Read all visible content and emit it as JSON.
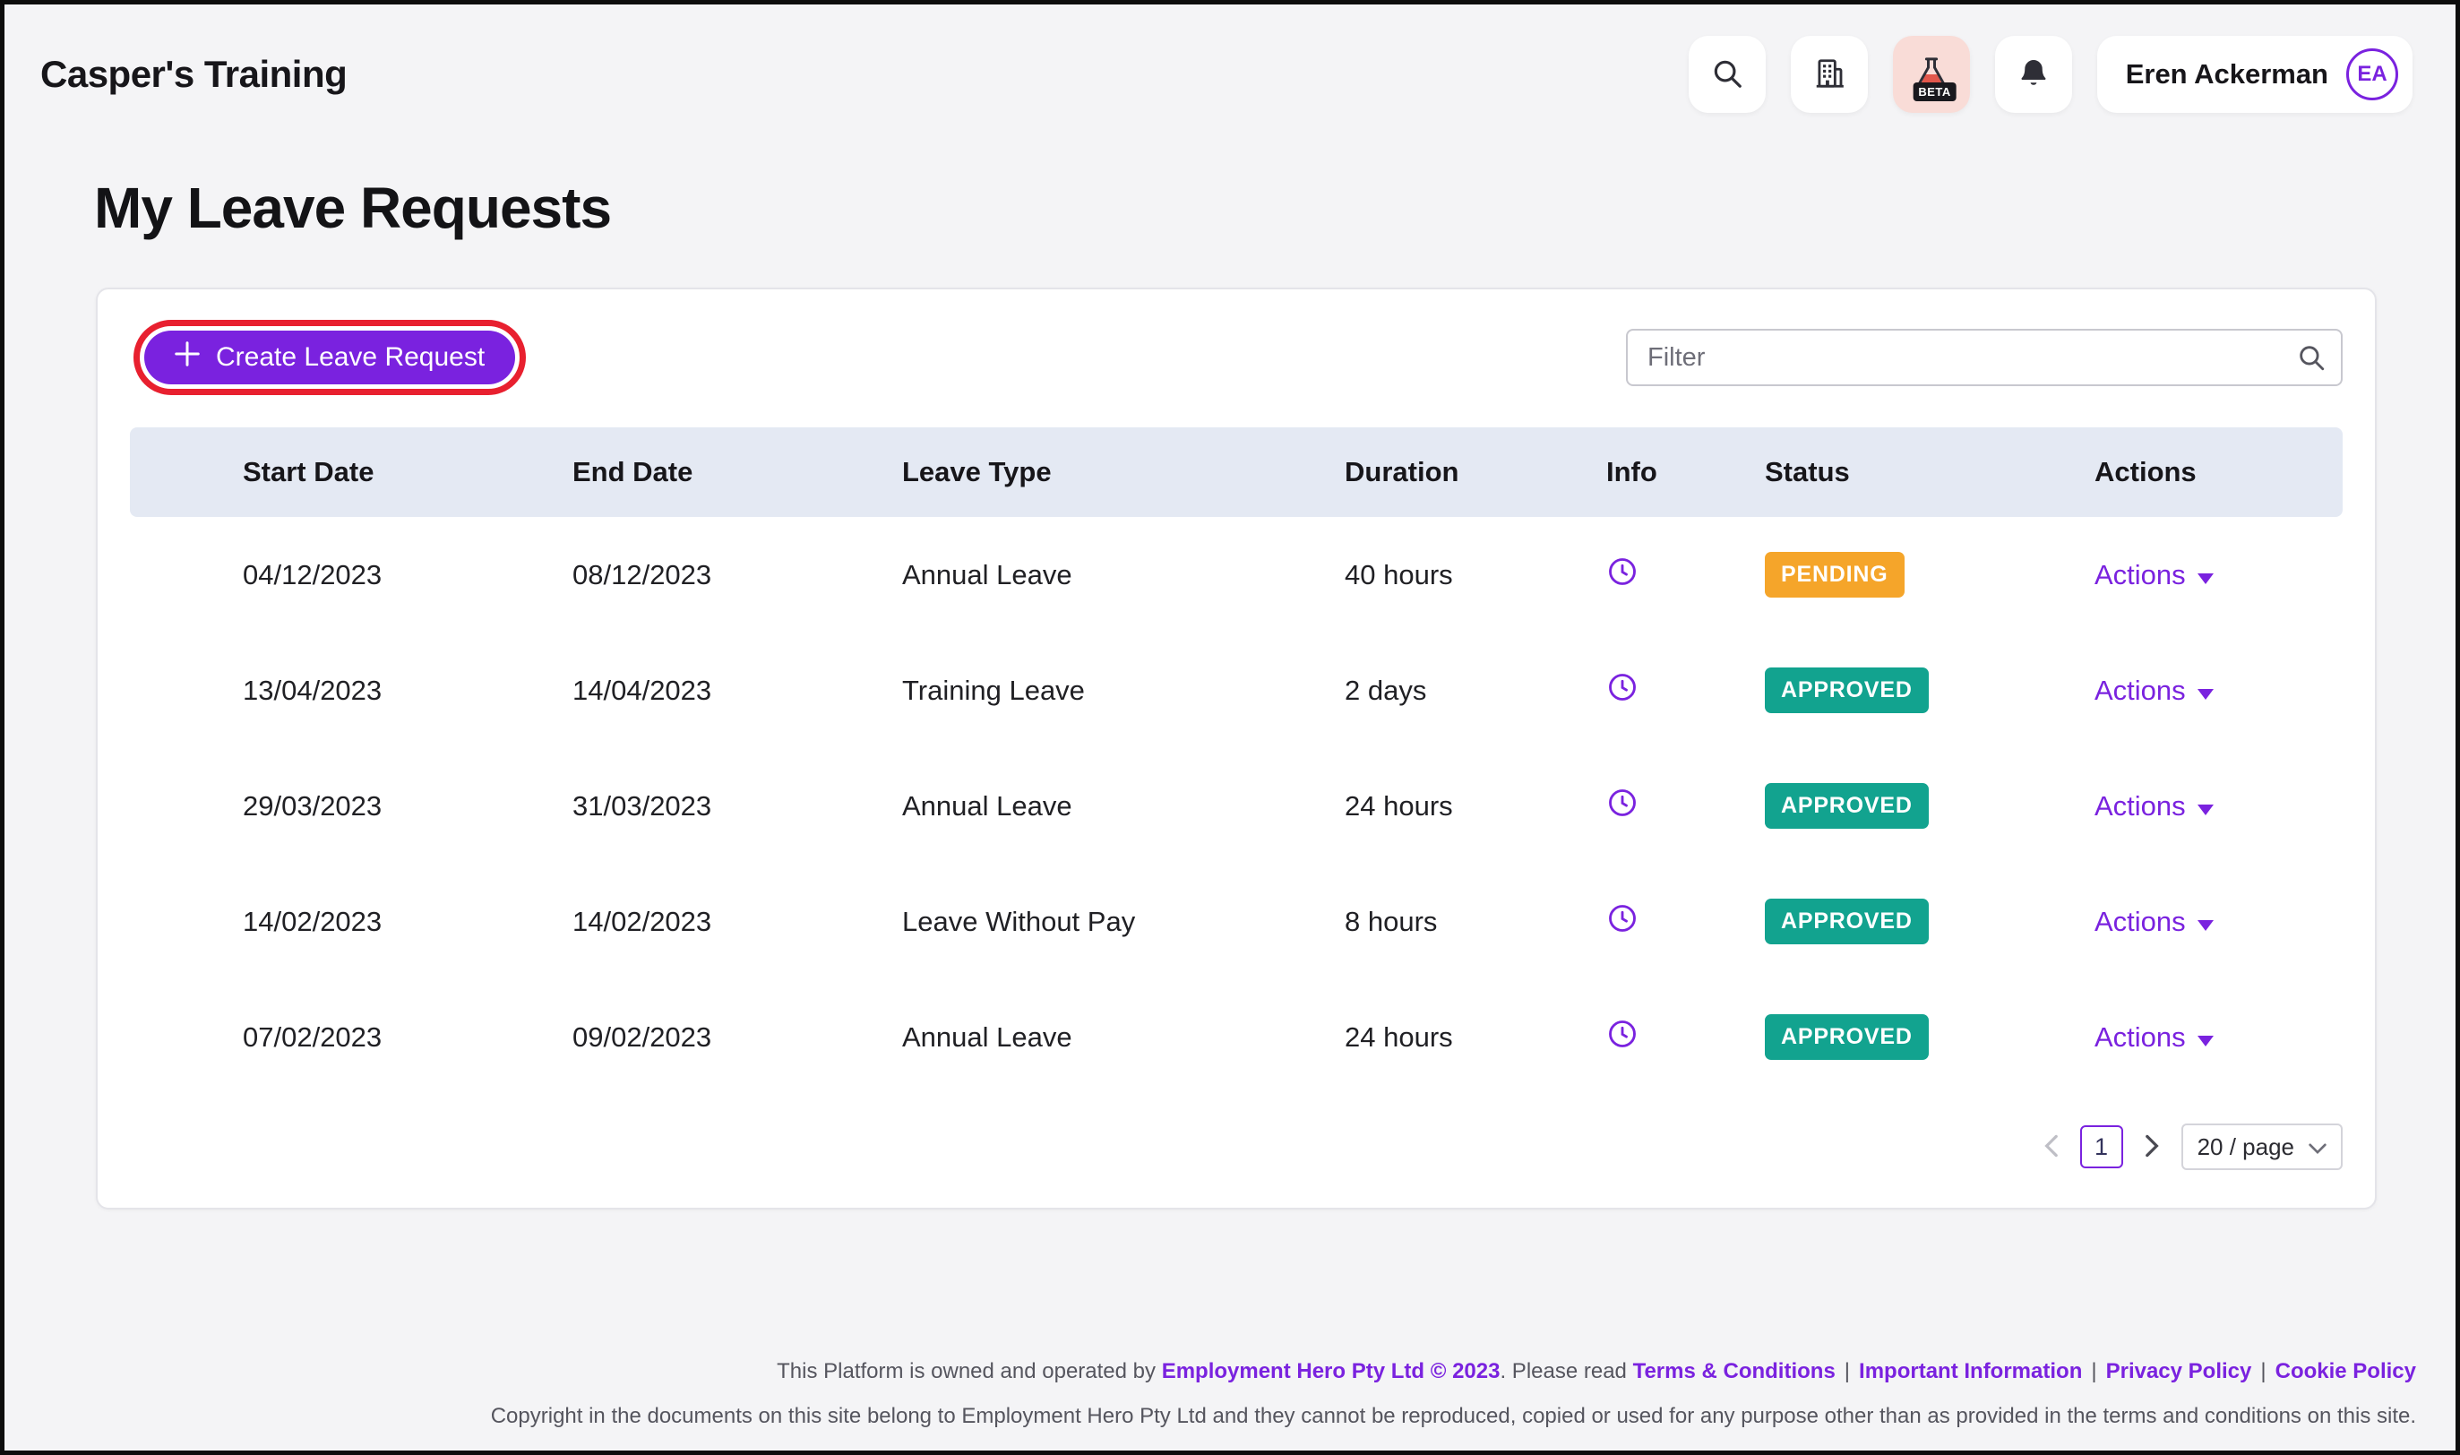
{
  "header": {
    "app_title": "Casper's Training",
    "user_name": "Eren Ackerman",
    "avatar_initials": "EA",
    "beta_label": "BETA"
  },
  "page": {
    "title": "My Leave Requests"
  },
  "toolbar": {
    "create_button_label": "Create Leave Request",
    "filter_placeholder": "Filter"
  },
  "table": {
    "columns": [
      "Start Date",
      "End Date",
      "Leave Type",
      "Duration",
      "Info",
      "Status",
      "Actions"
    ],
    "rows": [
      {
        "start_date": "04/12/2023",
        "end_date": "08/12/2023",
        "leave_type": "Annual Leave",
        "duration": "40 hours",
        "status": "PENDING",
        "actions_label": "Actions"
      },
      {
        "start_date": "13/04/2023",
        "end_date": "14/04/2023",
        "leave_type": "Training Leave",
        "duration": "2 days",
        "status": "APPROVED",
        "actions_label": "Actions"
      },
      {
        "start_date": "29/03/2023",
        "end_date": "31/03/2023",
        "leave_type": "Annual Leave",
        "duration": "24 hours",
        "status": "APPROVED",
        "actions_label": "Actions"
      },
      {
        "start_date": "14/02/2023",
        "end_date": "14/02/2023",
        "leave_type": "Leave Without Pay",
        "duration": "8 hours",
        "status": "APPROVED",
        "actions_label": "Actions"
      },
      {
        "start_date": "07/02/2023",
        "end_date": "09/02/2023",
        "leave_type": "Annual Leave",
        "duration": "24 hours",
        "status": "APPROVED",
        "actions_label": "Actions"
      }
    ]
  },
  "pagination": {
    "current_page": "1",
    "page_size": "20 / page"
  },
  "footer": {
    "line1_prefix": "This Platform is owned and operated by ",
    "company_link": "Employment Hero Pty Ltd © 2023",
    "line1_middle": ". Please read ",
    "links": [
      "Terms & Conditions",
      "Important Information",
      "Privacy Policy",
      "Cookie Policy"
    ],
    "separator": "|",
    "line2": "Copyright in the documents on this site belong to Employment Hero Pty Ltd and they cannot be reproduced, copied or used for any purpose other than as provided in the terms and conditions on this site."
  },
  "colors": {
    "accent": "#7A22DF",
    "highlight": "#E8202F",
    "orange": "#F5A52A",
    "teal": "#12A38F",
    "table-head": "#E4E9F3",
    "page-bg": "#F4F4F6",
    "text": "#17161A",
    "muted": "#55555E"
  }
}
